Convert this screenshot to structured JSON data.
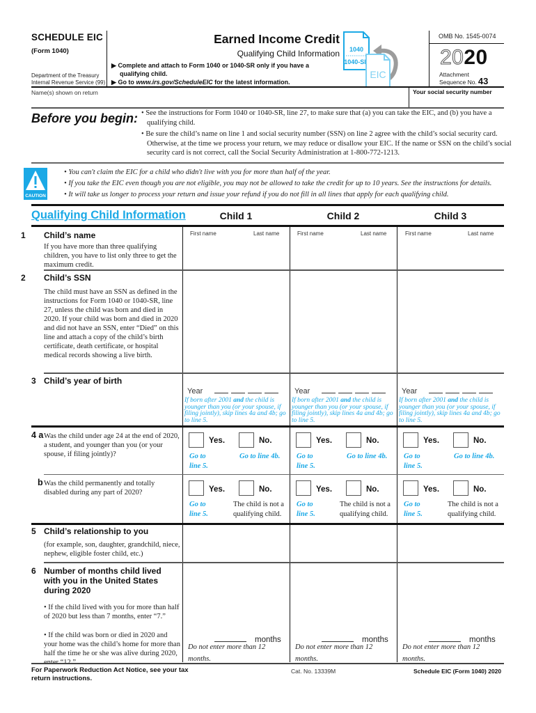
{
  "header": {
    "schedule_title": "SCHEDULE EIC",
    "form_number": "(Form 1040)",
    "department_line1": "Department of the Treasury",
    "department_line2": "Internal Revenue Service (99)",
    "title": "Earned Income Credit",
    "subtitle": "Qualifying Child Information",
    "instruction1_line1": "Complete and attach to Form 1040 or 1040-SR only if you have a",
    "instruction1_line2": "qualifying child.",
    "instruction2_prefix": "Go to",
    "instruction2_url": "www.irs.gov/ScheduleEIC",
    "instruction2_suffix": "for the latest information.",
    "icon_doc1_line1": "1040",
    "icon_doc1_line2": "1040-SR",
    "icon_doc2": "EIC",
    "omb": "OMB No. 1545-0074",
    "year_outline": "20",
    "year_bold": "20",
    "attachment_line1": "Attachment",
    "attachment_line2": "Sequence No.",
    "sequence_number": "43",
    "names_label": "Name(s) shown on return",
    "ssn_label": "Your social security number",
    "names_value": "",
    "ssn_value": ""
  },
  "before_you_begin": {
    "title": "Before you begin:",
    "bullets": [
      "See the instructions for Form 1040 or 1040-SR, line 27, to make sure that (a) you can take the EIC, and (b) you have a qualifying child.",
      "Be sure the child’s name on line 1 and social security number (SSN) on line 2 agree with the child’s social security card. Otherwise, at the time we process your return, we may reduce or disallow your EIC. If the name or SSN on the child’s social security card is not correct, call the Social Security Administration at 1-800-772-1213."
    ]
  },
  "caution": {
    "icon_label": "CAUTION",
    "bullets": [
      "You can't claim the EIC for a child who didn't live with you for more than half of the year.",
      "If you take the EIC even though you are not eligible, you may not be allowed to take the credit for up to 10 years. See the instructions for details.",
      "It will take us longer to process your return and issue your refund if you do not fill in all lines that apply for each qualifying child."
    ],
    "color": "#1ba9e6"
  },
  "section": {
    "title": "Qualifying Child Information",
    "children": [
      "Child 1",
      "Child 2",
      "Child 3"
    ]
  },
  "lines": {
    "l1": {
      "num": "1",
      "title": "Child’s name",
      "desc": "If you have more than three qualifying children, you have to list only three to get the maximum credit.",
      "first_name_label": "First name",
      "last_name_label": "Last name"
    },
    "l2": {
      "num": "2",
      "title": "Child’s SSN",
      "desc": "The child must have an SSN as defined in the instructions for Form 1040 or 1040-SR, line 27, unless the child was born and died in 2020. If your child was born and died in 2020 and did not have an SSN, enter “Died” on this line and attach a copy of the child’s birth certificate, death certificate, or hospital medical records showing a live birth."
    },
    "l3": {
      "num": "3",
      "title": "Child’s year of birth",
      "year_label": "Year",
      "note_part1": "If born after 2001",
      "note_and": "and",
      "note_part2": "the child is younger than you (or your spouse, if filing jointly), skip lines 4a and 4b; go to line 5."
    },
    "l4a": {
      "num": "4 a",
      "question": "Was the child under age 24 at the end of 2020, a student, and younger than you (or your spouse, if filing jointly)?",
      "yes_label": "Yes.",
      "no_label": "No.",
      "yes_note": "Go to line 5.",
      "no_note": "Go to line 4b."
    },
    "l4b": {
      "num": "b",
      "question": "Was the child permanently and totally disabled during any part of 2020?",
      "yes_label": "Yes.",
      "no_label": "No.",
      "yes_note": "Go to line 5.",
      "no_note": "The child is not a qualifying child."
    },
    "l5": {
      "num": "5",
      "title": "Child’s relationship to you",
      "desc": "(for example, son, daughter, grandchild, niece, nephew, eligible foster child, etc.)"
    },
    "l6": {
      "num": "6",
      "title": "Number of months child lived with you in the United States during 2020",
      "bullet1": "• If the child lived with you for more than half of 2020 but less than 7 months, enter “7.”",
      "bullet2": "• If the child was born or died in 2020 and your home was the child’s home for more than half the time he or she was alive during 2020, enter “12.”",
      "months_label": "months",
      "months_note": "Do not enter more than 12 months."
    }
  },
  "footer": {
    "left_line1": "For Paperwork Reduction Act Notice, see your tax",
    "left_line2": "return instructions.",
    "cat_no": "Cat. No. 13339M",
    "right": "Schedule EIC (Form 1040) 2020"
  }
}
